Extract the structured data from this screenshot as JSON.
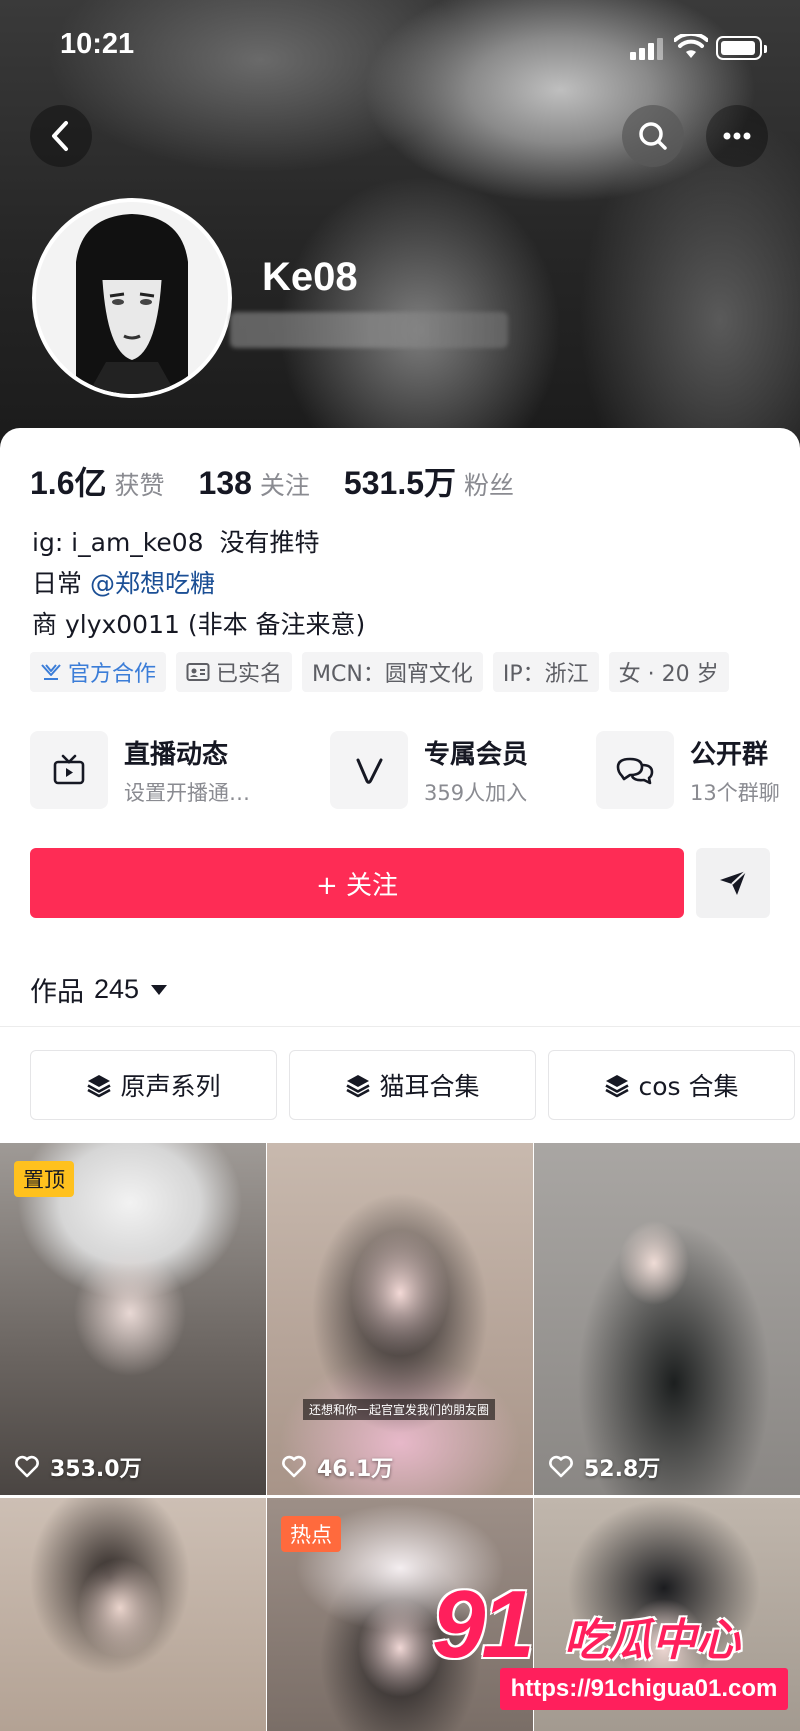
{
  "status_bar": {
    "time": "10:21"
  },
  "profile": {
    "username": "Ke08",
    "stats": [
      {
        "value": "1.6亿",
        "label": "获赞"
      },
      {
        "value": "138",
        "label": "关注"
      },
      {
        "value": "531.5万",
        "label": "粉丝"
      }
    ],
    "bio": {
      "line1": "ig: i_am_ke08  没有推特",
      "line2_prefix": "日常 ",
      "line2_mention": "@郑想吃糖",
      "line3": "商 ylyx0011 (非本 备注来意)"
    },
    "tags": [
      "官方合作",
      "已实名",
      "MCN：圆宵文化",
      "IP：浙江",
      "女 · 20 岁"
    ]
  },
  "features": [
    {
      "title": "直播动态",
      "sub": "设置开播通…",
      "icon": "tv-icon"
    },
    {
      "title": "专属会员",
      "sub": "359人加入",
      "icon": "v-icon"
    },
    {
      "title": "公开群",
      "sub": "13个群聊",
      "icon": "chat-icon"
    }
  ],
  "actions": {
    "follow_label": "+ 关注"
  },
  "works": {
    "label": "作品",
    "count": "245"
  },
  "collections": [
    "原声系列",
    "猫耳合集",
    "cos 合集"
  ],
  "videos": [
    {
      "likes": "353.0万",
      "badge": "置顶"
    },
    {
      "likes": "46.1万",
      "subtitle": "还想和你一起官宣发我们的朋友圈"
    },
    {
      "likes": "52.8万"
    },
    {
      "badge": "热点"
    }
  ],
  "watermark": {
    "number": "91",
    "text": "吃瓜中心",
    "url": "https://91chigua01.com"
  },
  "colors": {
    "accent": "#fe2c55",
    "mention": "#1b4f95",
    "official": "#3b7dd8"
  }
}
